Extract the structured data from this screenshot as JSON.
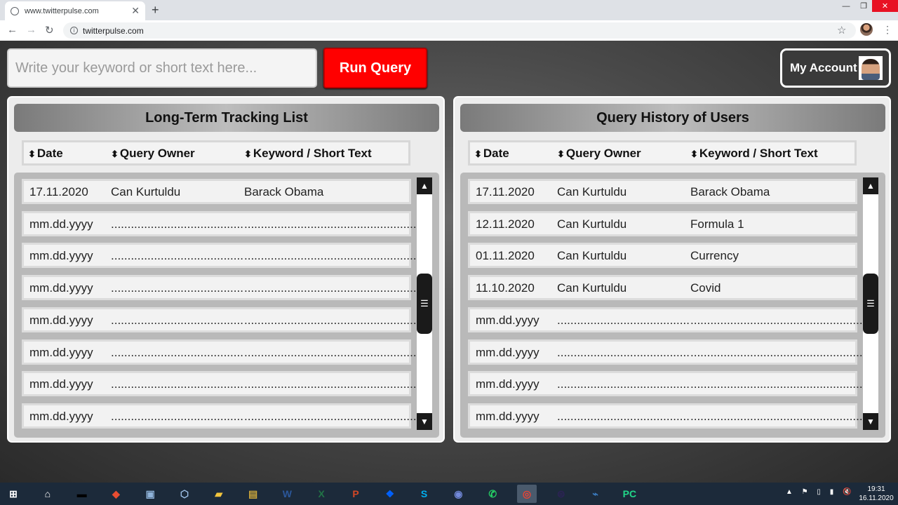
{
  "browser": {
    "tab_title": "www.twitterpulse.com",
    "tab_close": "✕",
    "new_tab": "+",
    "url": "twitterpulse.com",
    "window_controls": {
      "minimize": "—",
      "maximize": "❐",
      "close": "✕"
    },
    "nav": {
      "back": "←",
      "forward": "→",
      "reload": "↻",
      "info": "i",
      "bookmark": "☆",
      "menu": "⋮"
    }
  },
  "search": {
    "placeholder": "Write your keyword or short text here..."
  },
  "run_query": {
    "label": "Run Query"
  },
  "account": {
    "label": "My Account"
  },
  "columns": {
    "date": "Date",
    "owner": "Query Owner",
    "keyword": "Keyword / Short Text",
    "sort_glyph": "⬍"
  },
  "scrollbar": {
    "up": "▲",
    "down": "▼",
    "grip": "☰"
  },
  "tracking_list": {
    "title": "Long-Term Tracking List",
    "rows": [
      {
        "date": "17.11.2020",
        "owner": "Can Kurtuldu",
        "keyword": "Barack Obama"
      },
      {
        "date": "mm.dd.yyyy",
        "owner": "........................................",
        "keyword": "....................................................."
      },
      {
        "date": "mm.dd.yyyy",
        "owner": "........................................",
        "keyword": "....................................................."
      },
      {
        "date": "mm.dd.yyyy",
        "owner": "........................................",
        "keyword": "....................................................."
      },
      {
        "date": "mm.dd.yyyy",
        "owner": "........................................",
        "keyword": "....................................................."
      },
      {
        "date": "mm.dd.yyyy",
        "owner": "........................................",
        "keyword": "....................................................."
      },
      {
        "date": "mm.dd.yyyy",
        "owner": "........................................",
        "keyword": "....................................................."
      },
      {
        "date": "mm.dd.yyyy",
        "owner": "........................................",
        "keyword": "....................................................."
      }
    ]
  },
  "query_history": {
    "title": "Query History of Users",
    "rows": [
      {
        "date": "17.11.2020",
        "owner": "Can Kurtuldu",
        "keyword": "Barack Obama"
      },
      {
        "date": "12.11.2020",
        "owner": "Can Kurtuldu",
        "keyword": "Formula 1"
      },
      {
        "date": "01.11.2020",
        "owner": "Can Kurtuldu",
        "keyword": "Currency"
      },
      {
        "date": "11.10.2020",
        "owner": "Can Kurtuldu",
        "keyword": "Covid"
      },
      {
        "date": "mm.dd.yyyy",
        "owner": "........................................",
        "keyword": "....................................................."
      },
      {
        "date": "mm.dd.yyyy",
        "owner": "........................................",
        "keyword": "....................................................."
      },
      {
        "date": "mm.dd.yyyy",
        "owner": "........................................",
        "keyword": "....................................................."
      },
      {
        "date": "mm.dd.yyyy",
        "owner": "........................................",
        "keyword": "....................................................."
      }
    ]
  },
  "taskbar": {
    "apps": [
      {
        "icon": "windows-start-icon",
        "glyph": "⊞",
        "color": "#ffffff"
      },
      {
        "icon": "home-icon",
        "glyph": "⌂",
        "color": "#ffffff"
      },
      {
        "icon": "terminal-icon",
        "glyph": "▬",
        "color": "#000000"
      },
      {
        "icon": "git-icon",
        "glyph": "◆",
        "color": "#e84d31"
      },
      {
        "icon": "remote-desktop-icon",
        "glyph": "▣",
        "color": "#8fb3d9"
      },
      {
        "icon": "virtualbox-icon",
        "glyph": "⬡",
        "color": "#9fc2e8"
      },
      {
        "icon": "file-explorer-icon",
        "glyph": "▰",
        "color": "#f2c53d"
      },
      {
        "icon": "archive-icon",
        "glyph": "▤",
        "color": "#c9a43a"
      },
      {
        "icon": "word-icon",
        "glyph": "W",
        "color": "#2b579a"
      },
      {
        "icon": "excel-icon",
        "glyph": "X",
        "color": "#217346"
      },
      {
        "icon": "powerpoint-icon",
        "glyph": "P",
        "color": "#d24726"
      },
      {
        "icon": "dropbox-icon",
        "glyph": "❖",
        "color": "#0061ff"
      },
      {
        "icon": "skype-icon",
        "glyph": "S",
        "color": "#00aff0"
      },
      {
        "icon": "discord-icon",
        "glyph": "◉",
        "color": "#7289da"
      },
      {
        "icon": "whatsapp-icon",
        "glyph": "✆",
        "color": "#25d366"
      },
      {
        "icon": "chrome-icon",
        "glyph": "◎",
        "color": "#ea4335"
      },
      {
        "icon": "eclipse-icon",
        "glyph": "⊜",
        "color": "#2c2255"
      },
      {
        "icon": "mysql-workbench-icon",
        "glyph": "⌁",
        "color": "#3a7bbf"
      },
      {
        "icon": "pycharm-icon",
        "glyph": "PC",
        "color": "#21d789"
      }
    ],
    "tray": "▲ ⚑ ▯ ▮ 🔇",
    "time": "19:31",
    "date": "16.11.2020"
  }
}
